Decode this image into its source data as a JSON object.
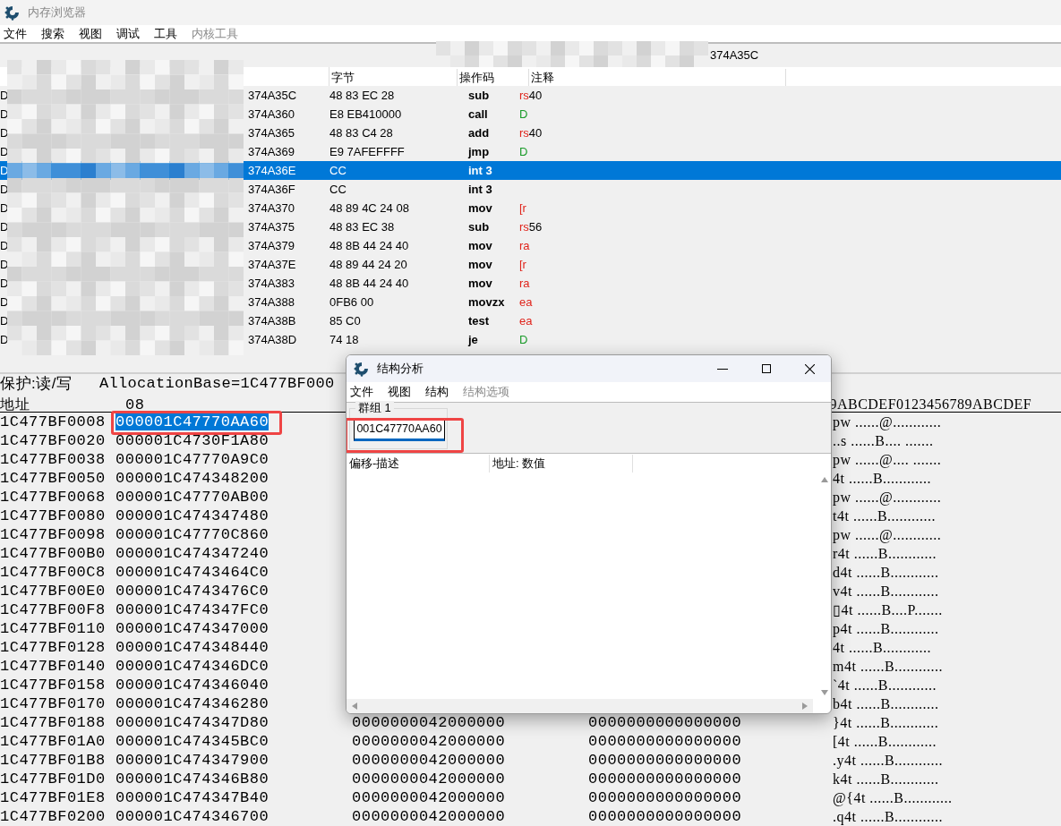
{
  "window": {
    "title": "内存浏览器"
  },
  "menu": [
    {
      "label": "文件",
      "disabled": false
    },
    {
      "label": "搜索",
      "disabled": false
    },
    {
      "label": "视图",
      "disabled": false
    },
    {
      "label": "调试",
      "disabled": false
    },
    {
      "label": "工具",
      "disabled": false
    },
    {
      "label": "内核工具",
      "disabled": true
    }
  ],
  "address_bar": {
    "value": "374A35C"
  },
  "disassembly": {
    "columns": [
      "字节",
      "操作码",
      "注释"
    ],
    "rows": [
      {
        "lead": "D",
        "address": "374A35C",
        "bytes": "48 83 EC 28",
        "opcode": "sub",
        "comment": [
          {
            "text": "rs",
            "kind": "reg"
          },
          {
            "text": "40",
            "kind": "num"
          }
        ],
        "selected": false
      },
      {
        "lead": "D",
        "address": "374A360",
        "bytes": "E8 EB410000",
        "opcode": "call",
        "comment": [
          {
            "text": "D",
            "kind": "label"
          }
        ],
        "selected": false
      },
      {
        "lead": "D",
        "address": "374A365",
        "bytes": "48 83 C4 28",
        "opcode": "add",
        "comment": [
          {
            "text": "rs",
            "kind": "reg"
          },
          {
            "text": "40",
            "kind": "num"
          }
        ],
        "selected": false
      },
      {
        "lead": "D",
        "address": "374A369",
        "bytes": "E9 7AFEFFFF",
        "opcode": "jmp",
        "comment": [
          {
            "text": "D",
            "kind": "label"
          }
        ],
        "selected": false
      },
      {
        "lead": "D",
        "address": "374A36E",
        "bytes": "CC",
        "opcode": "int 3",
        "comment": [],
        "selected": true
      },
      {
        "lead": "D",
        "address": "374A36F",
        "bytes": "CC",
        "opcode": "int 3",
        "comment": [],
        "selected": false
      },
      {
        "lead": "D",
        "address": "374A370",
        "bytes": "48 89 4C 24 08",
        "opcode": "mov",
        "comment": [
          {
            "text": "[r",
            "kind": "reg"
          }
        ],
        "selected": false
      },
      {
        "lead": "D",
        "address": "374A375",
        "bytes": "48 83 EC 38",
        "opcode": "sub",
        "comment": [
          {
            "text": "rs",
            "kind": "reg"
          },
          {
            "text": "56",
            "kind": "num"
          }
        ],
        "selected": false
      },
      {
        "lead": "D",
        "address": "374A379",
        "bytes": "48 8B 44 24 40",
        "opcode": "mov",
        "comment": [
          {
            "text": "ra",
            "kind": "reg"
          }
        ],
        "selected": false
      },
      {
        "lead": "D",
        "address": "374A37E",
        "bytes": "48 89 44 24 20",
        "opcode": "mov",
        "comment": [
          {
            "text": "[r",
            "kind": "reg"
          }
        ],
        "selected": false
      },
      {
        "lead": "D",
        "address": "374A383",
        "bytes": "48 8B 44 24 40",
        "opcode": "mov",
        "comment": [
          {
            "text": "ra",
            "kind": "reg"
          }
        ],
        "selected": false
      },
      {
        "lead": "D",
        "address": "374A388",
        "bytes": "0FB6 00",
        "opcode": "movzx",
        "comment": [
          {
            "text": "ea",
            "kind": "reg"
          }
        ],
        "selected": false
      },
      {
        "lead": "D",
        "address": "374A38B",
        "bytes": "85 C0",
        "opcode": "test",
        "comment": [
          {
            "text": "ea",
            "kind": "reg"
          }
        ],
        "selected": false
      },
      {
        "lead": "D",
        "address": "374A38D",
        "bytes": "74 18",
        "opcode": "je",
        "comment": [
          {
            "text": "D",
            "kind": "label"
          }
        ],
        "selected": false
      }
    ]
  },
  "hex": {
    "protection": "保护:读/写",
    "allocation": "AllocationBase=1C477BF000",
    "address_header": "地址",
    "column_header": "08",
    "ascii_header": "9ABCDEF0123456789ABCDEF",
    "rows": [
      {
        "address": "1C477BF0008",
        "col1": "000001C47770AA60",
        "selected": true,
        "ascii": "pw ......@............"
      },
      {
        "address": "1C477BF0020",
        "col1": "000001C4730F1A80",
        "selected": false,
        "ascii": "..s ......B.... ......."
      },
      {
        "address": "1C477BF0038",
        "col1": "000001C47770A9C0",
        "selected": false,
        "ascii": "pw ......@.... ......."
      },
      {
        "address": "1C477BF0050",
        "col1": "000001C474348200",
        "selected": false,
        "ascii": "4t ......B............"
      },
      {
        "address": "1C477BF0068",
        "col1": "000001C47770AB00",
        "selected": false,
        "ascii": "pw ......@............"
      },
      {
        "address": "1C477BF0080",
        "col1": "000001C474347480",
        "selected": false,
        "ascii": "t4t ......B............"
      },
      {
        "address": "1C477BF0098",
        "col1": "000001C47770C860",
        "selected": false,
        "ascii": "pw ......@............"
      },
      {
        "address": "1C477BF00B0",
        "col1": "000001C474347240",
        "selected": false,
        "ascii": "r4t ......B............"
      },
      {
        "address": "1C477BF00C8",
        "col1": "000001C4743464C0",
        "selected": false,
        "ascii": "d4t ......B............"
      },
      {
        "address": "1C477BF00E0",
        "col1": "000001C4743476C0",
        "selected": false,
        "ascii": "v4t ......B............"
      },
      {
        "address": "1C477BF00F8",
        "col1": "000001C474347FC0",
        "selected": false,
        "ascii": "▯4t ......B....P......."
      },
      {
        "address": "1C477BF0110",
        "col1": "000001C474347000",
        "selected": false,
        "ascii": "p4t ......B............"
      },
      {
        "address": "1C477BF0128",
        "col1": "000001C474348440",
        "selected": false,
        "ascii": "4t ......B............"
      },
      {
        "address": "1C477BF0140",
        "col1": "000001C474346DC0",
        "selected": false,
        "ascii": "m4t ......B............"
      },
      {
        "address": "1C477BF0158",
        "col1": "000001C474346040",
        "selected": false,
        "ascii": "`4t ......B............"
      },
      {
        "address": "1C477BF0170",
        "col1": "000001C474346280",
        "selected": false,
        "ascii": "b4t ......B............"
      },
      {
        "address": "1C477BF0188",
        "col1": "000001C474347D80",
        "col2": "0000000042000000",
        "col3": "0000000000000000",
        "selected": false,
        "ascii": "}4t ......B............"
      },
      {
        "address": "1C477BF01A0",
        "col1": "000001C474345BC0",
        "col2": "0000000042000000",
        "col3": "0000000000000000",
        "selected": false,
        "ascii": "[4t ......B............"
      },
      {
        "address": "1C477BF01B8",
        "col1": "000001C474347900",
        "col2": "0000000042000000",
        "col3": "0000000000000000",
        "selected": false,
        "ascii": ".y4t ......B............"
      },
      {
        "address": "1C477BF01D0",
        "col1": "000001C474346B80",
        "col2": "0000000042000000",
        "col3": "0000000000000000",
        "selected": false,
        "ascii": "k4t ......B............"
      },
      {
        "address": "1C477BF01E8",
        "col1": "000001C474347B40",
        "col2": "0000000042000000",
        "col3": "0000000000000000",
        "selected": false,
        "ascii": "@{4t ......B............"
      },
      {
        "address": "1C477BF0200",
        "col1": "000001C474346700",
        "col2": "0000000042000000",
        "col3": "0000000000000000",
        "selected": false,
        "ascii": ".q4t ......B............"
      }
    ]
  },
  "dialog": {
    "title": "结构分析",
    "menu": [
      {
        "label": "文件",
        "disabled": false
      },
      {
        "label": "视图",
        "disabled": false
      },
      {
        "label": "结构",
        "disabled": false
      },
      {
        "label": "结构选项",
        "disabled": true
      }
    ],
    "group": {
      "label": "群组 1",
      "value": "001C47770AA60",
      "focused": true
    },
    "columns": [
      "偏移-描述",
      "地址: 数值"
    ]
  }
}
